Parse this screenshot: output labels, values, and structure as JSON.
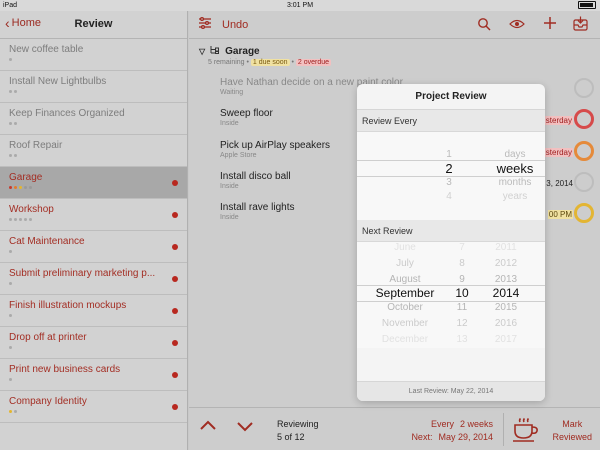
{
  "status_bar": {
    "device": "iPad",
    "time": "3:01 PM"
  },
  "sidebar": {
    "back_label": "Home",
    "title": "Review",
    "items": [
      {
        "label": "New coffee table",
        "dots": [
          "#aaaaaa"
        ],
        "flag": false,
        "active": false
      },
      {
        "label": "Install New Lightbulbs",
        "dots": [
          "#aaaaaa",
          "#aaaaaa"
        ],
        "flag": false,
        "active": false
      },
      {
        "label": "Keep Finances Organized",
        "dots": [
          "#aaaaaa",
          "#aaaaaa"
        ],
        "flag": false,
        "active": false
      },
      {
        "label": "Roof Repair",
        "dots": [
          "#aaaaaa",
          "#aaaaaa"
        ],
        "flag": false,
        "active": false
      },
      {
        "label": "Garage",
        "dots": [
          "#c83a2c",
          "#e47b2b",
          "#e4b62d",
          "#999999",
          "#999999"
        ],
        "flag": true,
        "active": true,
        "selected": true
      },
      {
        "label": "Workshop",
        "dots": [
          "#aaaaaa",
          "#aaaaaa",
          "#aaaaaa",
          "#aaaaaa",
          "#aaaaaa"
        ],
        "flag": true,
        "active": true
      },
      {
        "label": "Cat Maintenance",
        "dots": [
          "#aaaaaa"
        ],
        "flag": true,
        "active": true
      },
      {
        "label": "Submit preliminary marketing p...",
        "dots": [
          "#aaaaaa"
        ],
        "flag": true,
        "active": true
      },
      {
        "label": "Finish illustration mockups",
        "dots": [
          "#aaaaaa"
        ],
        "flag": true,
        "active": true
      },
      {
        "label": "Drop off at printer",
        "dots": [
          "#aaaaaa"
        ],
        "flag": true,
        "active": true
      },
      {
        "label": "Print new business cards",
        "dots": [
          "#aaaaaa"
        ],
        "flag": true,
        "active": true
      },
      {
        "label": "Company Identity",
        "dots": [
          "#e4b62d",
          "#aaaaaa"
        ],
        "flag": true,
        "active": true
      }
    ]
  },
  "toolbar": {
    "undo_label": "Undo"
  },
  "project": {
    "title": "Garage",
    "remaining": "5 remaining",
    "due_soon": "1 due soon",
    "overdue": "2 overdue"
  },
  "tasks": [
    {
      "title": "Have Nathan decide on a new paint color",
      "context": "Waiting",
      "right": "",
      "ring": "gray",
      "dim": true
    },
    {
      "title": "Sweep floor",
      "context": "Inside",
      "right": "sterday",
      "right_style": "red",
      "ring": "red"
    },
    {
      "title": "Pick up AirPlay speakers",
      "context": "Apple Store",
      "right": "sterday",
      "right_style": "red",
      "ring": "orange"
    },
    {
      "title": "Install disco ball",
      "context": "Inside",
      "right": "3, 2014",
      "right_style": "plain",
      "ring": "gray"
    },
    {
      "title": "Install rave lights",
      "context": "Inside",
      "right": "00 PM",
      "right_style": "yellow",
      "ring": "yellow"
    }
  ],
  "popover": {
    "title": "Project Review",
    "review_every_label": "Review Every",
    "interval": {
      "numbers": [
        "1",
        "2",
        "3",
        "4"
      ],
      "units": [
        "days",
        "weeks",
        "months",
        "years"
      ],
      "selected_number": "2",
      "selected_unit": "weeks"
    },
    "next_review_label": "Next Review",
    "date": {
      "months": [
        "June",
        "July",
        "August",
        "September",
        "October",
        "November",
        "December"
      ],
      "days": [
        "7",
        "8",
        "9",
        "10",
        "11",
        "12",
        "13"
      ],
      "years": [
        "2011",
        "2012",
        "2013",
        "2014",
        "2015",
        "2016",
        "2017"
      ],
      "selected_month": "September",
      "selected_day": "10",
      "selected_year": "2014"
    },
    "last_review": "Last Review: May 22, 2014"
  },
  "bottom_bar": {
    "reviewing_label": "Reviewing",
    "position": "5 of 12",
    "every_label": "Every",
    "every_value": "2 weeks",
    "next_label": "Next:",
    "next_value": "May 29, 2014",
    "mark_line1": "Mark",
    "mark_line2": "Reviewed"
  },
  "colors": {
    "accent": "#a02c22",
    "overdue": "#d64a4a",
    "due_soon": "#e3b533"
  }
}
